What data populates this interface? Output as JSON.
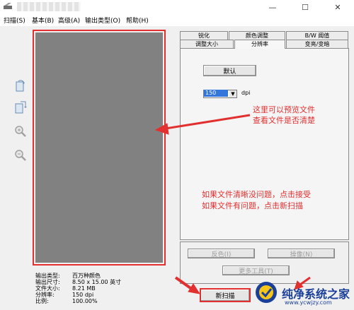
{
  "window": {
    "minimize_glyph": "—",
    "maximize_glyph": "☐",
    "close_glyph": "✕"
  },
  "menu": {
    "items": [
      {
        "label": "扫描(S)"
      },
      {
        "label": "基本(B)"
      },
      {
        "label": "高级(A)"
      },
      {
        "label": "输出类型(O)"
      },
      {
        "label": "帮助(H)"
      }
    ]
  },
  "toolbar": {
    "icons": [
      "rotate-page-icon",
      "flip-page-icon",
      "zoom-in-icon",
      "zoom-out-icon"
    ]
  },
  "info": {
    "type_label": "输出类型:",
    "type_value": "百万种颜色",
    "size_label": "输出尺寸:",
    "size_value": "8.50 x 15.00 英寸",
    "filesize_label": "文件大小:",
    "filesize_value": "8.21 MB",
    "resolution_label": "分辨率:",
    "resolution_value": "150 dpi",
    "scale_label": "比例:",
    "scale_value": "100.00%"
  },
  "tabs": {
    "row1": [
      {
        "label": "锐化"
      },
      {
        "label": "颜色调整"
      },
      {
        "label": "B/W 阈值"
      }
    ],
    "row2": [
      {
        "label": "调整大小"
      },
      {
        "label": "分辨率",
        "active": true
      },
      {
        "label": "变亮/变暗"
      }
    ]
  },
  "resolution_panel": {
    "default_button": "默认",
    "dpi_value": "150",
    "dpi_unit": "dpi"
  },
  "annotations": {
    "preview_note_line1": "这里可以预览文件",
    "preview_note_line2": "查看文件是否清楚",
    "accept_note_line1": "如果文件清晰没问题，点击接受",
    "accept_note_line2": "如果文件有问题，点击新扫描"
  },
  "bottom_buttons": {
    "invert": "反色(I)",
    "mirror": "操像(N)",
    "more_tools": "更多工具(T)",
    "new_scan": "新扫描"
  },
  "watermark": {
    "title": "纯净系统之家",
    "url": "www.ycwjzy.com"
  },
  "colors": {
    "annotation_red": "#e23030",
    "preview_gray": "#818181",
    "selection_blue": "#3377dd",
    "watermark_blue": "#1a3f99"
  }
}
